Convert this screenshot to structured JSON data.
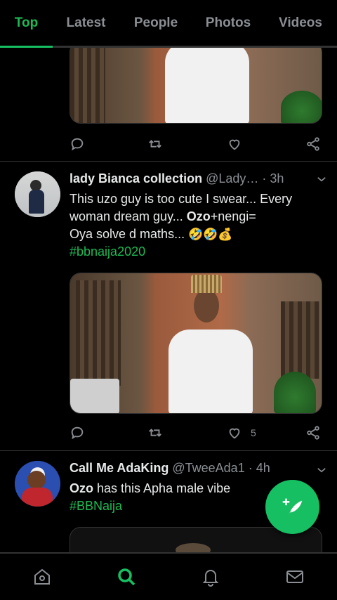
{
  "tabs": [
    {
      "label": "Top",
      "active": true
    },
    {
      "label": "Latest",
      "active": false
    },
    {
      "label": "People",
      "active": false
    },
    {
      "label": "Photos",
      "active": false
    },
    {
      "label": "Videos",
      "active": false
    }
  ],
  "tweets": [
    {
      "name": "lady Bianca collection",
      "handle": "@Lady…",
      "time": "· 3h",
      "text_line1": "This uzo guy is too cute I swear... Every",
      "text_line2_pre": "woman dream guy... ",
      "text_line2_bold": "Ozo",
      "text_line2_post": "+nengi=",
      "text_line3": "Oya solve d maths... ",
      "emojis": "🤣🤣💰",
      "hashtag": "#bbnaija2020",
      "like_count": "5"
    },
    {
      "name": "Call Me AdaKing",
      "handle": "@TweeAda1",
      "time": "· 4h",
      "text_bold": "Ozo",
      "text_post": " has this Apha male vibe",
      "hashtag": "#BBNaija"
    }
  ],
  "accent_color": "#17bf63",
  "icons": {
    "reply": "reply-icon",
    "retweet": "retweet-icon",
    "like": "heart-icon",
    "share": "share-icon",
    "fab": "compose-feather-icon",
    "nav": [
      "home-icon",
      "search-icon",
      "bell-icon",
      "mail-icon"
    ]
  }
}
